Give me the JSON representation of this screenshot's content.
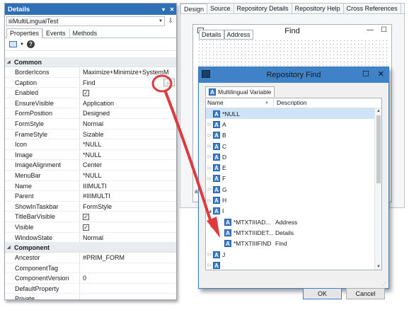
{
  "details": {
    "title": "Details",
    "object": "iiiMultiLingualTest",
    "tabs": [
      "Properties",
      "Events",
      "Methods"
    ],
    "categories": [
      {
        "name": "Common",
        "properties": [
          {
            "name": "BorderIcons",
            "value": "Maximize+Minimize+SystemM"
          },
          {
            "name": "Caption",
            "value": "Find",
            "button": "..."
          },
          {
            "name": "Enabled",
            "check": true
          },
          {
            "name": "EnsureVisible",
            "value": "Application"
          },
          {
            "name": "FormPosition",
            "value": "Designed"
          },
          {
            "name": "FormStyle",
            "value": "Normal"
          },
          {
            "name": "FrameStyle",
            "value": "Sizable"
          },
          {
            "name": "Icon",
            "value": "*NULL"
          },
          {
            "name": "Image",
            "value": "*NULL"
          },
          {
            "name": "ImageAlignment",
            "value": "Center"
          },
          {
            "name": "MenuBar",
            "value": "*NULL"
          },
          {
            "name": "Name",
            "value": "IIIMULTI"
          },
          {
            "name": "Parent",
            "value": "#IIIMULTI"
          },
          {
            "name": "ShowInTaskbar",
            "value": "FormStyle"
          },
          {
            "name": "TitleBarVisible",
            "check": true
          },
          {
            "name": "Visible",
            "check": true
          },
          {
            "name": "WindowState",
            "value": "Normal"
          }
        ]
      },
      {
        "name": "Component",
        "properties": [
          {
            "name": "Ancestor",
            "value": "#PRIM_FORM"
          },
          {
            "name": "ComponentTag",
            "value": ""
          },
          {
            "name": "ComponentVersion",
            "value": "0"
          },
          {
            "name": "DefaultProperty",
            "value": ""
          },
          {
            "name": "Private",
            "value": ""
          },
          {
            "name": "Prote",
            "value": ""
          }
        ]
      }
    ]
  },
  "editor_tabs": [
    "Design",
    "Source",
    "Repository Details",
    "Repository Help",
    "Cross References"
  ],
  "find_form": {
    "title": "Find",
    "tabs": [
      "Details",
      "Address"
    ],
    "side_char": "a"
  },
  "repo_find": {
    "title": "Repository Find",
    "tab": "Multilingual Variable",
    "col_name": "Name",
    "col_desc": "Description",
    "rows": [
      {
        "label": "*NULL",
        "selected": true
      },
      {
        "label": "A",
        "expander": "▷"
      },
      {
        "label": "B",
        "expander": "▷"
      },
      {
        "label": "C",
        "expander": "▷"
      },
      {
        "label": "D",
        "expander": "▷"
      },
      {
        "label": "E",
        "expander": "▷"
      },
      {
        "label": "F",
        "expander": "▷"
      },
      {
        "label": "G",
        "expander": "▷"
      },
      {
        "label": "H",
        "expander": "▷"
      },
      {
        "label": "I",
        "expander": "◢"
      },
      {
        "label": "*MTXTIIIAD...",
        "desc": "Address",
        "child": true
      },
      {
        "label": "*MTXTIIIDET...",
        "desc": "Details",
        "child": true
      },
      {
        "label": "*MTXTIIIFIND",
        "desc": "Find",
        "child": true
      },
      {
        "label": "J",
        "expander": "▷"
      },
      {
        "label": "",
        "expander": "▷"
      }
    ],
    "ok": "OK",
    "cancel": "Cancel"
  },
  "colors": {
    "accent": "#3f82c8",
    "selection": "#cde3f7",
    "annotation": "#e0393b"
  }
}
